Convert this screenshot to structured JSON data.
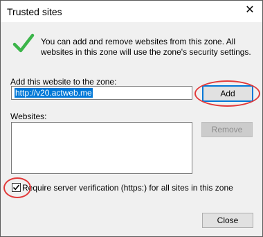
{
  "window": {
    "title": "Trusted sites"
  },
  "info": {
    "text": "You can add and remove websites from this zone. All websites in this zone will use the zone's security settings."
  },
  "add_section": {
    "label": "Add this website to the zone:",
    "input_value": "http://v20.actweb.me",
    "add_button": "Add"
  },
  "websites_section": {
    "label": "Websites:",
    "remove_button": "Remove",
    "items": []
  },
  "verification": {
    "checked": true,
    "label": "Require server verification (https:) for all sites in this zone"
  },
  "footer": {
    "close_button": "Close"
  },
  "colors": {
    "accent": "#0078d7",
    "highlight_oval": "#e23a3a",
    "check_green": "#3cb54a"
  },
  "icons": {
    "close": "close-icon",
    "check": "checkmark-icon"
  }
}
